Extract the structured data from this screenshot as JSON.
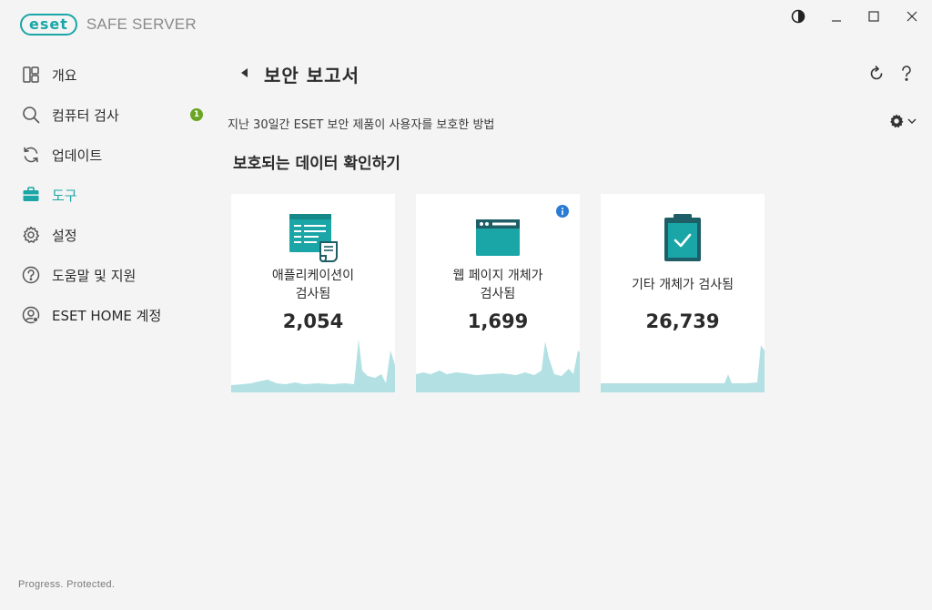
{
  "app": {
    "logo_text": "eset",
    "product_name": "SAFE SERVER",
    "tagline": "Progress. Protected."
  },
  "window_controls": [
    {
      "name": "theme-toggle-button",
      "icon": "contrast-icon"
    },
    {
      "name": "minimize-button",
      "icon": "minimize-icon"
    },
    {
      "name": "maximize-button",
      "icon": "maximize-icon"
    },
    {
      "name": "close-button",
      "icon": "close-icon"
    }
  ],
  "sidebar": {
    "items": [
      {
        "label": "개요",
        "icon": "overview-icon"
      },
      {
        "label": "컴퓨터 검사",
        "icon": "scan-icon",
        "badge": "1"
      },
      {
        "label": "업데이트",
        "icon": "update-icon"
      },
      {
        "label": "도구",
        "icon": "tools-icon",
        "active": true
      },
      {
        "label": "설정",
        "icon": "settings-icon"
      },
      {
        "label": "도움말 및 지원",
        "icon": "help-icon"
      },
      {
        "label": "ESET HOME 계정",
        "icon": "account-icon"
      }
    ]
  },
  "header": {
    "title": "보안 보고서"
  },
  "report": {
    "subtitle": "지난 30일간 ESET 보안 제품이 사용자를 보호한 방법",
    "section_title": "보호되는 데이터 확인하기",
    "cards": [
      {
        "label_line1": "애플리케이션이",
        "label_line2": "검사됨",
        "value": "2,054",
        "icon": "application-scan-icon"
      },
      {
        "label_line1": "웹 페이지 개체가",
        "label_line2": "검사됨",
        "value": "1,699",
        "icon": "web-page-icon",
        "has_info": true
      },
      {
        "label_line1": "기타 개체가 검사됨",
        "value": "26,739",
        "icon": "clipboard-check-icon"
      }
    ]
  },
  "colors": {
    "accent": "#1aa6a6",
    "badge": "#6aa422",
    "sparkline": "#b2e0e3",
    "info": "#2a7bd4"
  }
}
